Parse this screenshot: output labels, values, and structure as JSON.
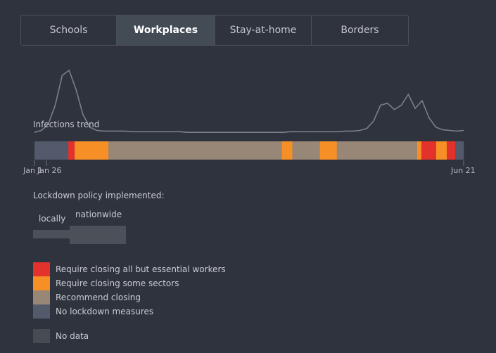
{
  "tabs": [
    {
      "label": "Schools",
      "active": false
    },
    {
      "label": "Workplaces",
      "active": true
    },
    {
      "label": "Stay-at-home",
      "active": false
    },
    {
      "label": "Borders",
      "active": false
    }
  ],
  "trend": {
    "label": "Infections trend",
    "color": "#7b7f88",
    "values": [
      0.02,
      0.05,
      0.15,
      0.45,
      0.92,
      1.0,
      0.7,
      0.3,
      0.1,
      0.05,
      0.04,
      0.04,
      0.04,
      0.04,
      0.03,
      0.03,
      0.03,
      0.03,
      0.03,
      0.03,
      0.03,
      0.03,
      0.02,
      0.02,
      0.02,
      0.02,
      0.02,
      0.02,
      0.02,
      0.02,
      0.02,
      0.02,
      0.02,
      0.02,
      0.02,
      0.02,
      0.02,
      0.03,
      0.03,
      0.03,
      0.03,
      0.03,
      0.03,
      0.03,
      0.03,
      0.04,
      0.04,
      0.05,
      0.08,
      0.2,
      0.45,
      0.48,
      0.38,
      0.45,
      0.62,
      0.4,
      0.52,
      0.25,
      0.1,
      0.06,
      0.05,
      0.04,
      0.05
    ]
  },
  "timeline": {
    "start_label": "Jan 1",
    "first_label": "Jan 26",
    "end_label": "Jun 21",
    "segments": [
      {
        "category": "none",
        "days": 16
      },
      {
        "category": "essential",
        "days": 3
      },
      {
        "category": "some",
        "days": 16
      },
      {
        "category": "recommend",
        "days": 82
      },
      {
        "category": "some",
        "days": 5
      },
      {
        "category": "recommend",
        "days": 13
      },
      {
        "category": "some",
        "days": 8
      },
      {
        "category": "recommend",
        "days": 38
      },
      {
        "category": "some",
        "days": 2
      },
      {
        "category": "essential",
        "days": 7
      },
      {
        "category": "some",
        "days": 5
      },
      {
        "category": "essential",
        "days": 4
      },
      {
        "category": "none",
        "days": 4
      }
    ]
  },
  "colors": {
    "essential": "#e3322b",
    "some": "#f58f26",
    "recommend": "#988677",
    "none": "#535a6b",
    "nodata": "#474b52"
  },
  "policy": {
    "title": "Lockdown policy implemented:",
    "locally": "locally",
    "nationwide": "nationwide"
  },
  "legend": [
    {
      "key": "essential",
      "label": "Require closing all but essential workers"
    },
    {
      "key": "some",
      "label": "Require closing some sectors"
    },
    {
      "key": "recommend",
      "label": "Recommend closing"
    },
    {
      "key": "none",
      "label": "No lockdown measures"
    }
  ],
  "nodata_label": "No data"
}
